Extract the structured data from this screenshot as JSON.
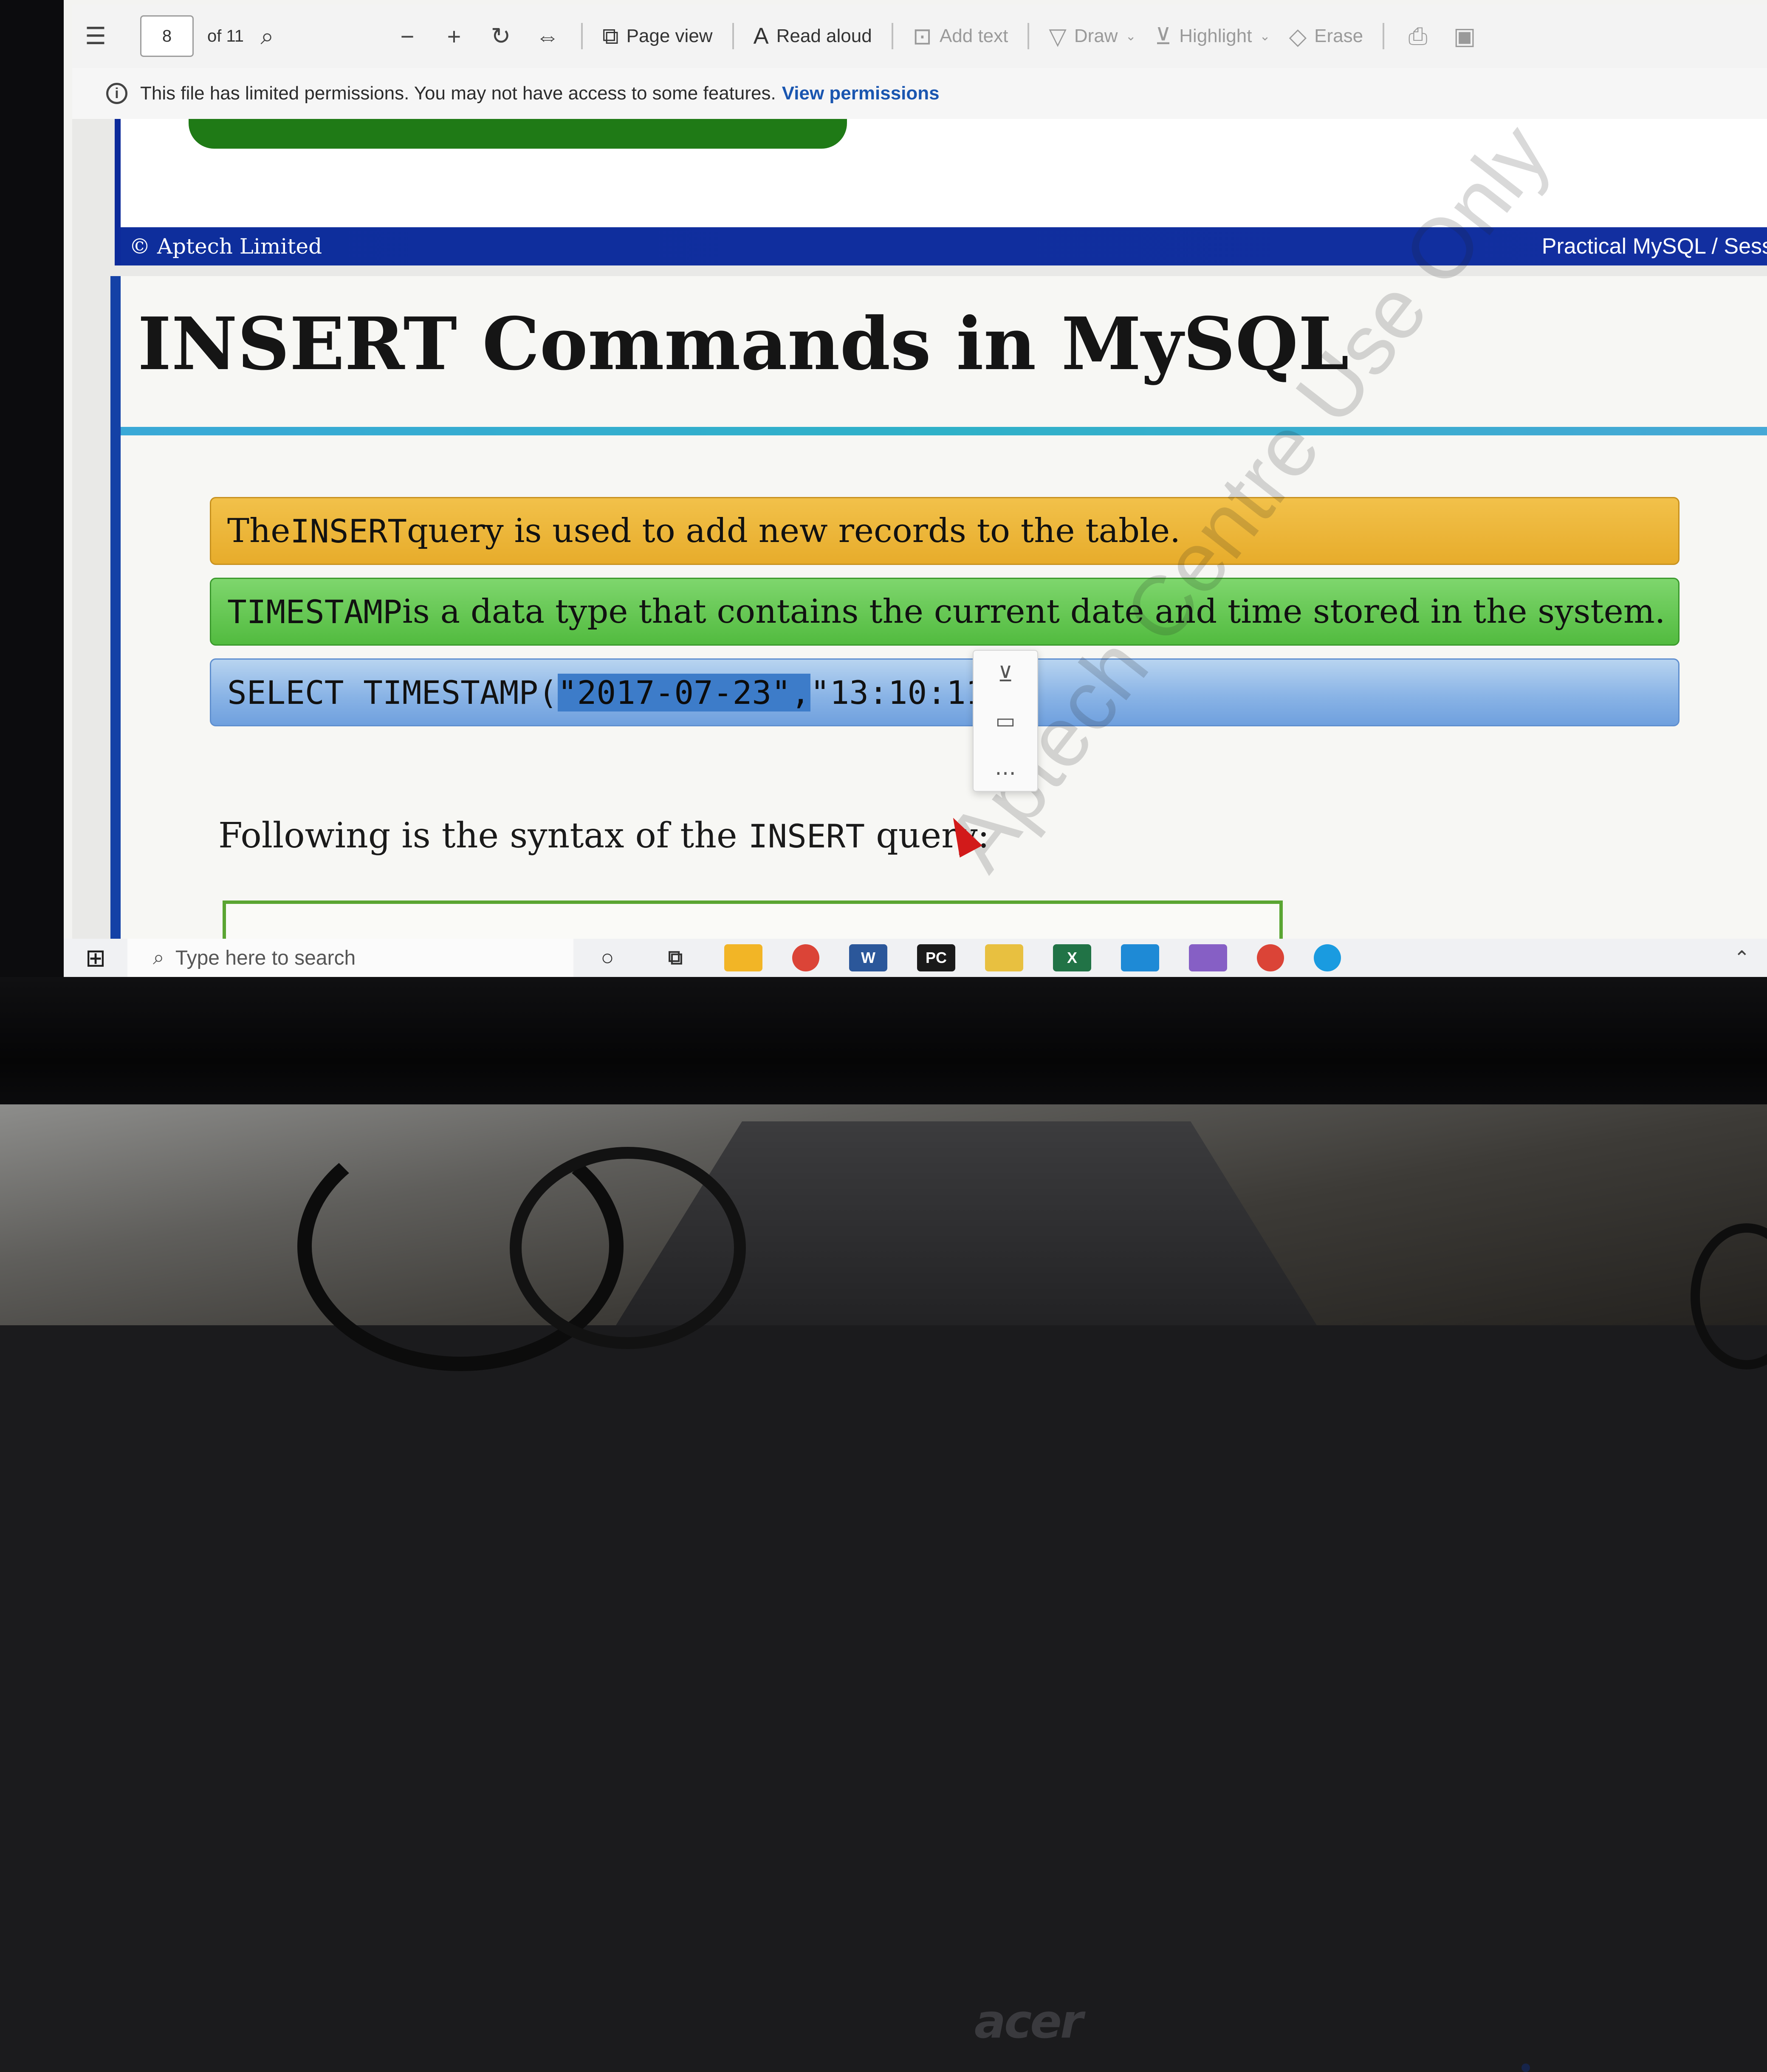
{
  "toolbar": {
    "contents_icon": "table-of-contents-icon",
    "page_number": "8",
    "page_total": "of 11",
    "search_icon": "search-icon",
    "zoom_out_icon": "minus-icon",
    "zoom_in_icon": "plus-icon",
    "rotate_icon": "rotate-icon",
    "fit_icon": "fit-width-icon",
    "page_view_label": "Page view",
    "read_aloud_label": "Read aloud",
    "add_text_label": "Add text",
    "draw_label": "Draw",
    "highlight_label": "Highlight",
    "erase_label": "Erase",
    "print_icon": "print-icon",
    "save_icon": "save-icon"
  },
  "permissions_bar": {
    "message": "This file has limited permissions. You may not have access to some features.",
    "link": "View permissions"
  },
  "previous_page": {
    "footer_left": "© Aptech Limited",
    "footer_right": "Practical MySQL / Sess"
  },
  "page": {
    "title": "INSERT Commands in MySQL",
    "band_1": {
      "before": "The ",
      "code": "INSERT",
      "after": " query is used to add new records to the table."
    },
    "band_2": {
      "code": "TIMESTAMP",
      "after": " is a data type that contains the current date and time stored in the system."
    },
    "band_3": {
      "prefix": "SELECT TIMESTAMP(",
      "selected": "\"2017-07-23\",",
      "suffix": " \"13:10:11\");"
    },
    "syntax_intro": {
      "before": "Following is the syntax of the ",
      "code": "INSERT",
      "after": "  query:"
    },
    "watermark": "Aptech Centre Use Only"
  },
  "selection_menu": {
    "items": [
      "highlight-icon",
      "comment-icon",
      "more-icon"
    ]
  },
  "taskbar": {
    "search_placeholder": "Type here to search",
    "apps": [
      {
        "name": "file-explorer",
        "color": "#f2b526",
        "label": ""
      },
      {
        "name": "chrome",
        "color": "#db4437",
        "label": ""
      },
      {
        "name": "word",
        "color": "#2b579a",
        "label": "W"
      },
      {
        "name": "pycharm",
        "color": "#1a1a1a",
        "label": "PC"
      },
      {
        "name": "folder",
        "color": "#e8c040",
        "label": ""
      },
      {
        "name": "excel",
        "color": "#217346",
        "label": "X"
      },
      {
        "name": "vs-code",
        "color": "#1e8ad6",
        "label": ""
      },
      {
        "name": "visual-studio",
        "color": "#865fc5",
        "label": ""
      },
      {
        "name": "chrome-alt",
        "color": "#db4437",
        "label": ""
      },
      {
        "name": "edge",
        "color": "#1a9be0",
        "label": ""
      }
    ]
  },
  "monitor": {
    "brand": "acer"
  },
  "colors": {
    "band_1": "#e9b234",
    "band_2": "#5fc24a",
    "band_3": "#8ab4e6",
    "accent_blue": "#1441a6",
    "link": "#1a56b0"
  }
}
